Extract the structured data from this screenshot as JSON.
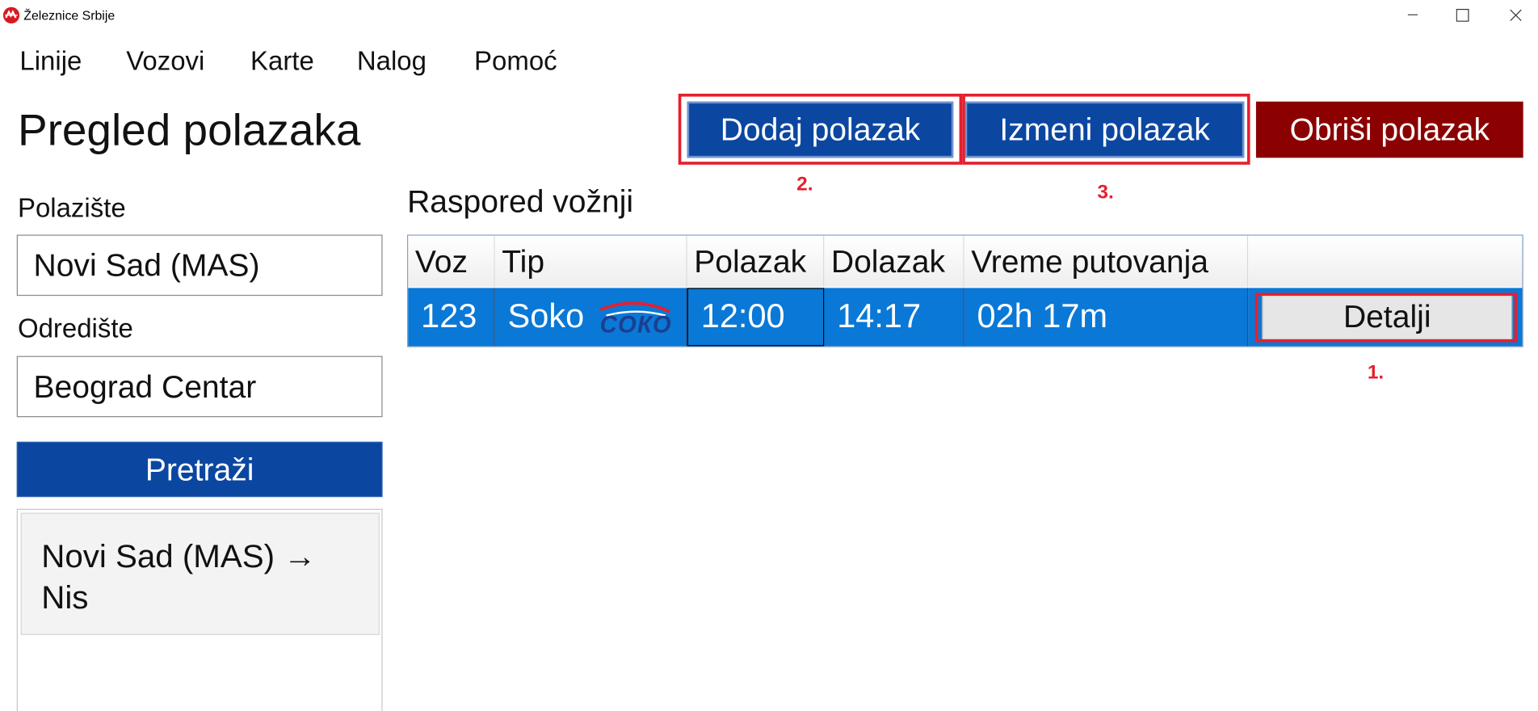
{
  "window": {
    "title": "Železnice Srbije",
    "logo_icon": "zs-railway-logo",
    "controls": [
      "minimize-icon",
      "maximize-icon",
      "close-icon"
    ]
  },
  "menu": {
    "items": [
      "Linije",
      "Vozovi",
      "Karte",
      "Nalog",
      "Pomoć"
    ]
  },
  "page": {
    "title": "Pregled polazaka"
  },
  "actions": {
    "add_label": "Dodaj polazak",
    "edit_label": "Izmeni polazak",
    "delete_label": "Obriši polazak"
  },
  "annotations": {
    "details": "1.",
    "add": "2.",
    "edit": "3."
  },
  "search": {
    "origin_label": "Polazište",
    "origin_value": "Novi Sad (MAS)",
    "destination_label": "Odredište",
    "destination_value": "Beograd Centar",
    "button_label": "Pretraži"
  },
  "routes": {
    "items": [
      "Novi Sad (MAS) → Nis"
    ]
  },
  "schedule": {
    "title": "Raspored vožnji",
    "columns": [
      "Voz",
      "Tip",
      "Polazak",
      "Dolazak",
      "Vreme putovanja",
      ""
    ],
    "rows": [
      {
        "train": "123",
        "type": "Soko",
        "type_logo_text": "СОКО",
        "departure": "12:00",
        "arrival": "14:17",
        "duration": "02h 17m",
        "details_label": "Detalji"
      }
    ]
  },
  "colors": {
    "primary_blue": "#0b47a1",
    "danger_red": "#8b0000",
    "selection_blue": "#0a78d6",
    "annotation_red": "#e5202e"
  }
}
